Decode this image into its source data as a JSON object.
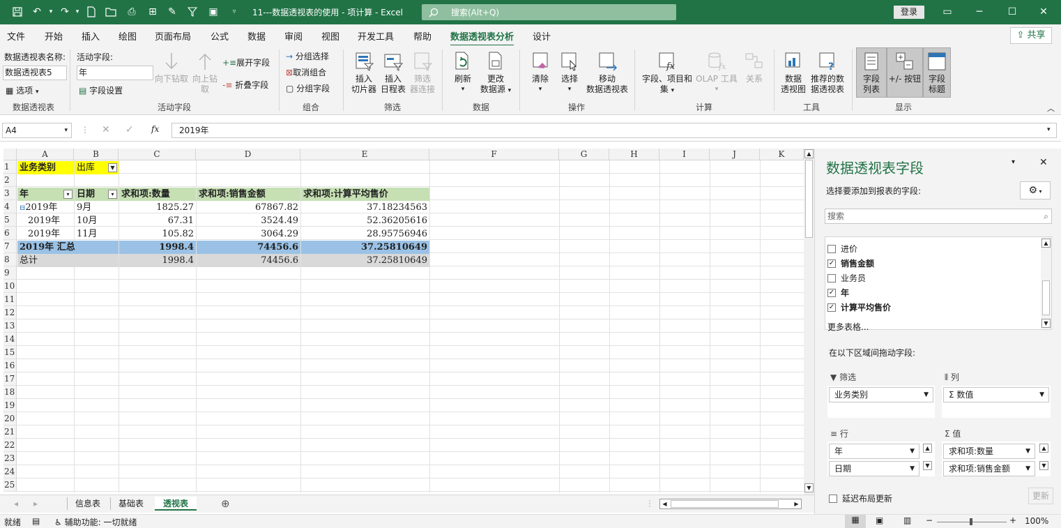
{
  "titlebar": {
    "title": "11---数据透视表的使用 - 项计算 - Excel",
    "search_placeholder": "搜索(Alt+Q)",
    "login": "登录"
  },
  "menu": {
    "tabs": [
      "文件",
      "开始",
      "插入",
      "绘图",
      "页面布局",
      "公式",
      "数据",
      "审阅",
      "视图",
      "开发工具",
      "帮助",
      "数据透视表分析",
      "设计"
    ],
    "active": "数据透视表分析",
    "share": "共享"
  },
  "ribbon": {
    "pivot_name_label": "数据透视表名称:",
    "pivot_name_value": "数据透视表5",
    "options": "选项",
    "group_pivot": "数据透视表",
    "active_field_label": "活动字段:",
    "active_field_value": "年",
    "field_settings": "字段设置",
    "drill_down": "向下钻取",
    "drill_up_1": "向上钻",
    "drill_up_2": "取",
    "expand_field": "展开字段",
    "collapse_field": "折叠字段",
    "group_active": "活动字段",
    "group_selection": "分组选择",
    "ungroup": "取消组合",
    "group_field": "分组字段",
    "group_group": "组合",
    "insert_slicer_1": "插入",
    "insert_slicer_2": "切片器",
    "insert_timeline_1": "插入",
    "insert_timeline_2": "日程表",
    "filter_conn_1": "筛选",
    "filter_conn_2": "器连接",
    "group_filter": "筛选",
    "refresh": "刷新",
    "change_source_1": "更改",
    "change_source_2": "数据源",
    "group_data": "数据",
    "clear": "清除",
    "select": "选择",
    "move_1": "移动",
    "move_2": "数据透视表",
    "group_actions": "操作",
    "fields_items_1": "字段、项目和",
    "fields_items_2": "集",
    "olap": "OLAP 工具",
    "relations": "关系",
    "group_calc": "计算",
    "pivot_chart_1": "数据",
    "pivot_chart_2": "透视图",
    "recommended_1": "推荐的数",
    "recommended_2": "据透视表",
    "group_tools": "工具",
    "field_list_1": "字段",
    "field_list_2": "列表",
    "buttons": "+/- 按钮",
    "headers_1": "字段",
    "headers_2": "标题",
    "group_show": "显示"
  },
  "formula_bar": {
    "name_box": "A4",
    "formula": "2019年"
  },
  "columns": [
    "A",
    "B",
    "C",
    "D",
    "E",
    "F",
    "G",
    "H",
    "I",
    "J",
    "K"
  ],
  "rows": [
    "1",
    "2",
    "3",
    "4",
    "5",
    "6",
    "7",
    "8",
    "9",
    "10",
    "11",
    "12",
    "13",
    "14",
    "15",
    "16",
    "17",
    "18",
    "19",
    "20",
    "21",
    "22",
    "23",
    "24",
    "25"
  ],
  "pivot": {
    "filter_label": "业务类别",
    "filter_value": "出库",
    "headers": [
      "年",
      "日期",
      "求和项:数量",
      "求和项:销售金额",
      "求和项:计算平均售价"
    ],
    "rows": [
      {
        "year": "2019年",
        "date": "9月",
        "qty": "1825.27",
        "amount": "67867.82",
        "avg": "37.18234563"
      },
      {
        "year": "2019年",
        "date": "10月",
        "qty": "67.31",
        "amount": "3524.49",
        "avg": "52.36205616"
      },
      {
        "year": "2019年",
        "date": "11月",
        "qty": "105.82",
        "amount": "3064.29",
        "avg": "28.95756946"
      }
    ],
    "subtotal": {
      "label": "2019年 汇总",
      "qty": "1998.4",
      "amount": "74456.6",
      "avg": "37.25810649"
    },
    "total": {
      "label": "总计",
      "qty": "1998.4",
      "amount": "74456.6",
      "avg": "37.25810649"
    }
  },
  "sheets": [
    "信息表",
    "基础表",
    "透视表"
  ],
  "active_sheet": "透视表",
  "status": {
    "ready": "就绪",
    "accessibility": "辅助功能: 一切就绪",
    "zoom": "100%"
  },
  "pane": {
    "title": "数据透视表字段",
    "choose_label": "选择要添加到报表的字段:",
    "search_placeholder": "搜索",
    "fields": [
      {
        "label": "进价",
        "checked": false
      },
      {
        "label": "销售金额",
        "checked": true
      },
      {
        "label": "业务员",
        "checked": false
      },
      {
        "label": "年",
        "checked": true
      },
      {
        "label": "计算平均售价",
        "checked": true
      }
    ],
    "more_tables": "更多表格...",
    "drag_label": "在以下区域间拖动字段:",
    "filters_label": "筛选",
    "columns_label": "列",
    "rows_label": "行",
    "values_label": "值",
    "filter_item": "业务类别",
    "column_item": "Σ 数值",
    "row_items": [
      "年",
      "日期"
    ],
    "value_items": [
      "求和项:数量",
      "求和项:销售金额"
    ],
    "defer_label": "延迟布局更新",
    "update": "更新"
  },
  "colors": {
    "excel_green": "#217346",
    "yellow": "#ffff00",
    "green_header": "#c6e0b4",
    "blue_subtotal": "#9bc2e6",
    "gray_total": "#d9d9d9"
  }
}
